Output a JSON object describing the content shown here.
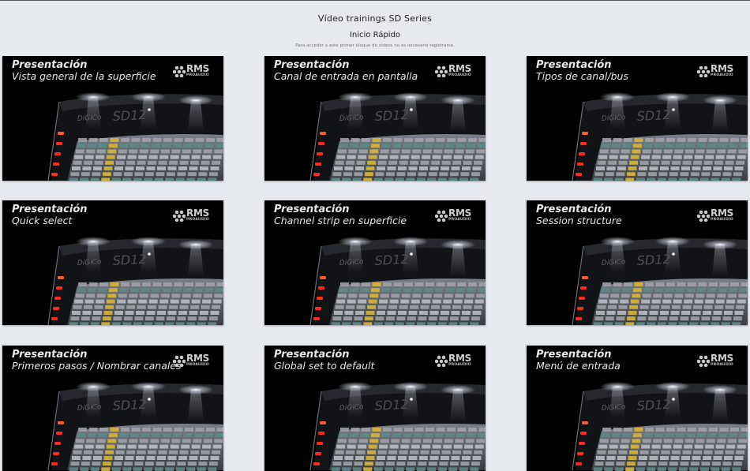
{
  "header": {
    "title": "Vídeo trainings SD Series",
    "section": "Inicio Rápido",
    "note": "Para acceder a este primer bloque de videos no es necesario registrarse."
  },
  "brand": {
    "name": "RMS",
    "sub": "PROAUDIO"
  },
  "console": {
    "maker": "DiGiCo",
    "model": "SD12"
  },
  "videos": [
    {
      "heading": "Presentación",
      "subtitle": "Vista general de la superficie"
    },
    {
      "heading": "Presentación",
      "subtitle": "Canal de entrada en pantalla"
    },
    {
      "heading": "Presentación",
      "subtitle": "Tipos de canal/bus"
    },
    {
      "heading": "Presentación",
      "subtitle": "Quick select"
    },
    {
      "heading": "Presentación",
      "subtitle": "Channel strip en superficie"
    },
    {
      "heading": "Presentación",
      "subtitle": "Session structure"
    },
    {
      "heading": "Presentación",
      "subtitle": "Primeros pasos / Nombrar canales"
    },
    {
      "heading": "Presentación",
      "subtitle": "Global set to default"
    },
    {
      "heading": "Presentación",
      "subtitle": "Menú de entrada"
    }
  ],
  "colors": {
    "background": "#e6e9ee",
    "thumbnail": "#000000",
    "accent_led": "#ff2a1a",
    "fader_yellow": "#d8b63a"
  }
}
